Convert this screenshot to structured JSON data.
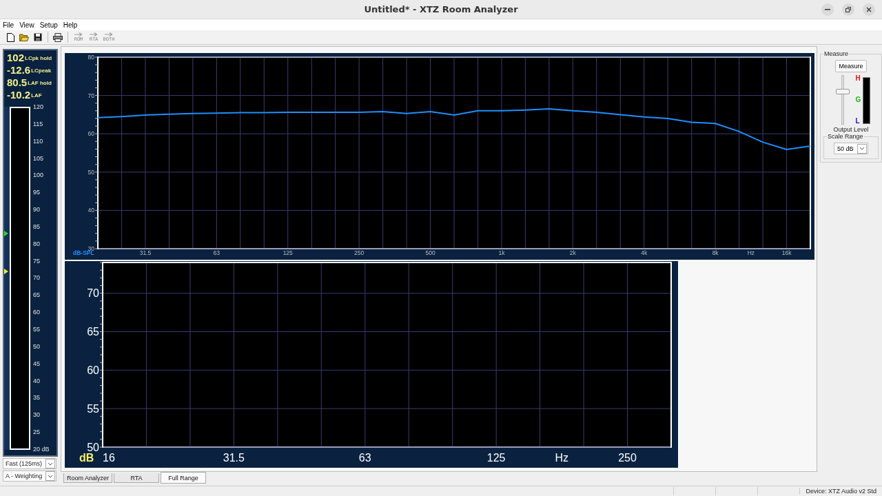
{
  "window": {
    "title": "Untitled* - XTZ Room Analyzer"
  },
  "menu": [
    "File",
    "View",
    "Setup",
    "Help"
  ],
  "mode_buttons": [
    {
      "label": "ROM",
      "disabled": true
    },
    {
      "label": "RTA",
      "disabled": true
    },
    {
      "label": "BOTH",
      "disabled": true
    }
  ],
  "meter": {
    "readings": [
      {
        "value": "102",
        "label": "LCpk hold"
      },
      {
        "value": "-12.6",
        "label": "LCpeak"
      },
      {
        "value": "80.5",
        "label": "LAF hold"
      },
      {
        "value": "-10.2",
        "label": "LAF"
      }
    ],
    "scale": [
      "120",
      "115",
      "110",
      "105",
      "100",
      "95",
      "90",
      "85",
      "80",
      "75",
      "70",
      "65",
      "60",
      "55",
      "50",
      "45",
      "40",
      "35",
      "30",
      "25",
      "20 dB"
    ],
    "markers": [
      {
        "level": 0.63,
        "color": "#22dd22"
      },
      {
        "level": 0.52,
        "color": "#eeee22"
      }
    ]
  },
  "response_select": {
    "value": "Fast (125ms)"
  },
  "weighting_select": {
    "value": "A - Weighting"
  },
  "top_chart": {
    "chart_data": {
      "type": "line",
      "grid": true,
      "ylabel": "dB-SPL",
      "xlabel": "Hz",
      "ylim": [
        30,
        80
      ],
      "categories": [
        null,
        null,
        "31.5",
        null,
        null,
        "63",
        null,
        null,
        "125",
        null,
        null,
        "250",
        null,
        null,
        "500",
        null,
        null,
        "1k",
        null,
        null,
        "2k",
        null,
        null,
        "4k",
        null,
        null,
        "8k",
        null,
        null,
        "16k",
        null
      ],
      "yticks": [
        30,
        40,
        50,
        60,
        70,
        80
      ],
      "series": [
        {
          "color": "#1e8fff",
          "values": [
            64.2,
            64.5,
            64.9,
            65.1,
            65.3,
            65.4,
            65.5,
            65.5,
            65.6,
            65.6,
            65.6,
            65.6,
            65.8,
            65.3,
            65.8,
            64.9,
            66,
            66,
            66.2,
            66.5,
            66,
            65.6,
            65,
            64.4,
            64,
            63,
            62.7,
            60.6,
            57.8,
            55.9,
            56.8
          ]
        }
      ]
    }
  },
  "bottom_chart": {
    "chart_data": {
      "type": "line",
      "grid": true,
      "ylabel": "dB",
      "xlabel": "Hz",
      "ylim": [
        50,
        74
      ],
      "categories": [
        "16",
        null,
        null,
        "31.5",
        null,
        null,
        "63",
        null,
        null,
        "125",
        null,
        null,
        "250",
        null
      ],
      "yticks": [
        50,
        55,
        60,
        65,
        70
      ]
    }
  },
  "tabs": [
    {
      "label": "Room Analyzer",
      "selected": false
    },
    {
      "label": "RTA",
      "selected": false
    },
    {
      "label": "Full Range",
      "selected": true
    }
  ],
  "measure_panel": {
    "title": "Measure",
    "button": "Measure",
    "indicators": [
      {
        "letter": "H",
        "color": "#ee1111"
      },
      {
        "letter": "G",
        "color": "#11bb11"
      },
      {
        "letter": "L",
        "color": "#1111dd"
      }
    ],
    "output_level": {
      "label": "Output Level",
      "level": 0.68
    },
    "scale_range": {
      "title": "Scale Range",
      "value": "50 dB"
    }
  },
  "status_bar": {
    "device": "Device: XTZ Audio v2 Std"
  }
}
